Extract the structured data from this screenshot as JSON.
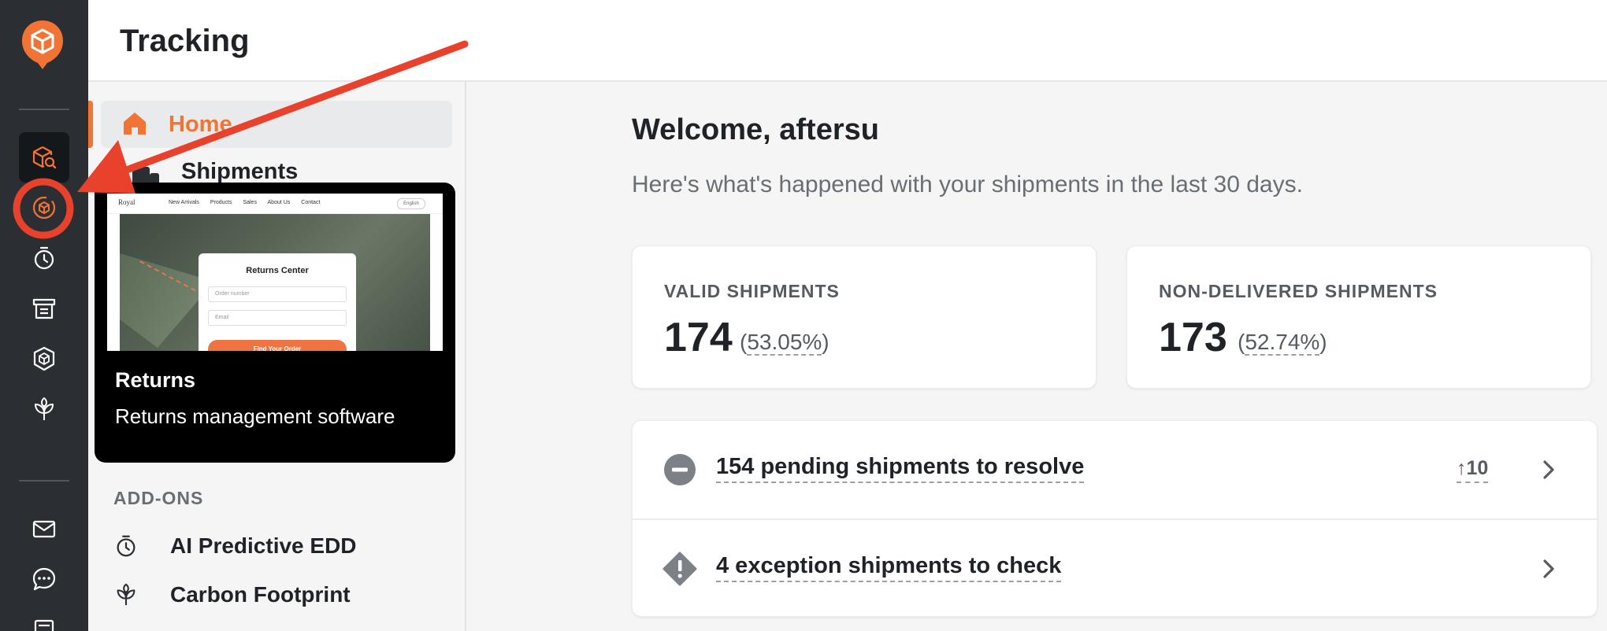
{
  "app": {
    "page_title": "Tracking"
  },
  "rail": {
    "items": [
      {
        "name": "tracking",
        "icon": "box-search-icon",
        "active": true
      },
      {
        "name": "returns",
        "icon": "box-return-icon",
        "active": false
      },
      {
        "name": "edd",
        "icon": "stopwatch-icon",
        "active": false
      },
      {
        "name": "shopping",
        "icon": "storefront-icon",
        "active": false
      },
      {
        "name": "protection",
        "icon": "shield-box-icon",
        "active": false
      },
      {
        "name": "carbon",
        "icon": "sprout-icon",
        "active": false
      },
      {
        "name": "mail",
        "icon": "mail-icon",
        "active": false
      },
      {
        "name": "chat",
        "icon": "chat-icon",
        "active": false
      }
    ]
  },
  "sidebar": {
    "nav": [
      {
        "label": "Home",
        "icon": "home-icon",
        "active": true
      },
      {
        "label": "Shipments",
        "icon": "truck-icon",
        "active": false
      }
    ],
    "promo": {
      "title": "Returns",
      "subtitle": "Returns management software",
      "preview": {
        "brand": "Royal",
        "menu": [
          "New Arrivals",
          "Products",
          "Sales",
          "About Us",
          "Contact"
        ],
        "language": "English",
        "card_title": "Returns Center",
        "order_placeholder": "Order number",
        "email_placeholder": "Email",
        "button": "Find Your Order"
      }
    },
    "addons_heading": "ADD-ONS",
    "addons": [
      {
        "label": "AI Predictive EDD",
        "icon": "stopwatch-icon"
      },
      {
        "label": "Carbon Footprint",
        "icon": "sprout-icon"
      }
    ]
  },
  "main": {
    "welcome": "Welcome, aftersu",
    "subtitle": "Here's what's happened with your shipments in the last 30 days.",
    "stats": [
      {
        "label": "VALID SHIPMENTS",
        "value": "174",
        "percent": "53.05%"
      },
      {
        "label": "NON-DELIVERED SHIPMENTS",
        "value": "173",
        "percent": "52.74%"
      }
    ],
    "tasks": [
      {
        "text": "154 pending shipments to resolve",
        "icon": "minus-circle-icon",
        "trend": "10"
      },
      {
        "text": "4 exception shipments to check",
        "icon": "warning-diamond-icon",
        "trend": ""
      }
    ]
  },
  "colors": {
    "brand": "#f27435",
    "rail_bg": "#2b2f33",
    "annotation": "#e8412c"
  }
}
